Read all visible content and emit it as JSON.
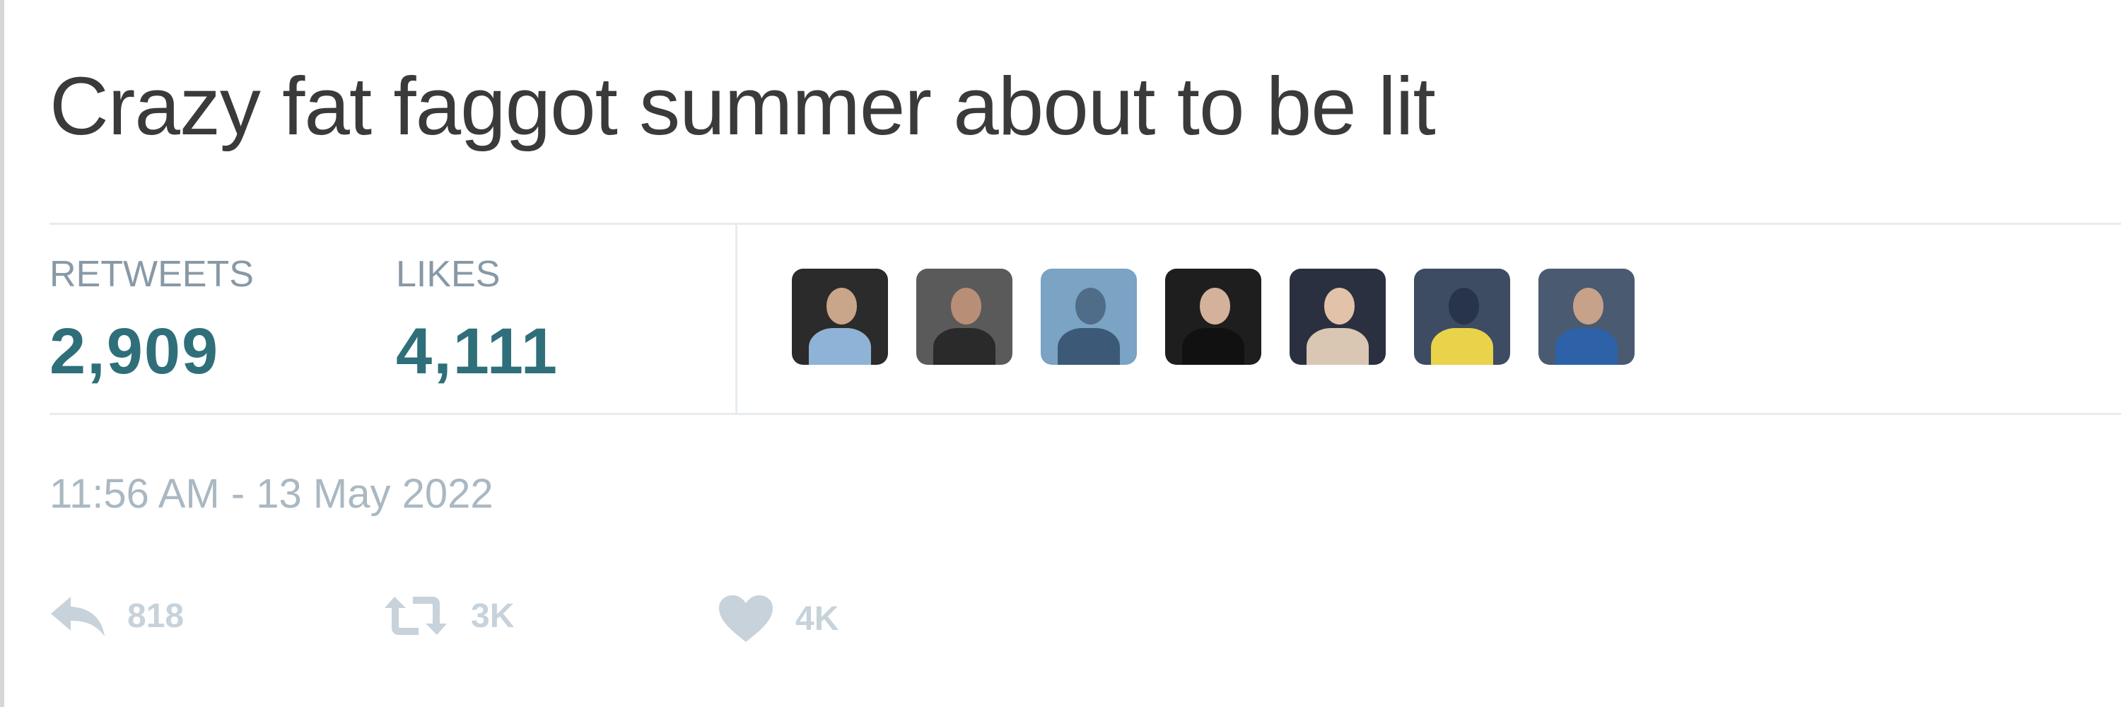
{
  "tweet": {
    "text": "Crazy fat faggot summer about to be lit",
    "timestamp": "11:56 AM - 13 May 2022"
  },
  "stats": {
    "retweets_label": "RETWEETS",
    "retweets_count": "2,909",
    "likes_label": "LIKES",
    "likes_count": "4,111"
  },
  "avatars": [
    {
      "icon": "user-avatar-1"
    },
    {
      "icon": "user-avatar-2"
    },
    {
      "icon": "user-avatar-3"
    },
    {
      "icon": "user-avatar-4"
    },
    {
      "icon": "user-avatar-5"
    },
    {
      "icon": "user-avatar-6"
    },
    {
      "icon": "user-avatar-7"
    }
  ],
  "actions": {
    "reply_count": "818",
    "retweet_count": "3K",
    "like_count": "4K"
  },
  "colors": {
    "count_color": "#2f6f7a",
    "label_color": "#8899a6",
    "muted_color": "#aab8c2"
  }
}
